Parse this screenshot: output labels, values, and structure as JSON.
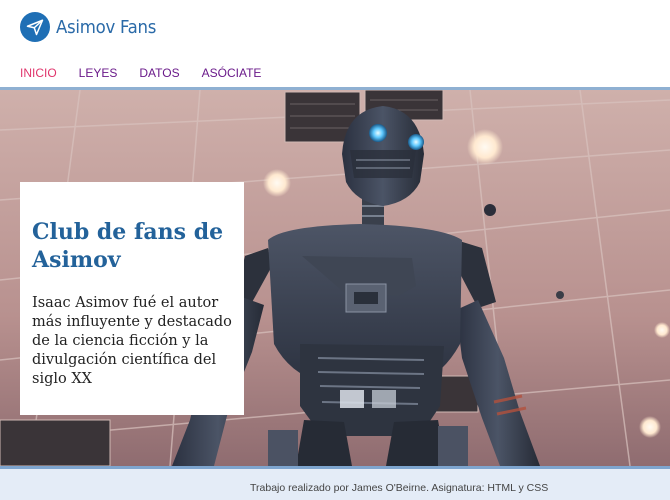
{
  "header": {
    "logo_text": "Asimov Fans",
    "logo_icon": "paper-plane-icon"
  },
  "nav": {
    "items": [
      "INICIO",
      "LEYES",
      "DATOS",
      "ASÓCIATE"
    ],
    "active": "INICIO"
  },
  "hero": {
    "title": "Club de fans de Asimov",
    "text": "Isaac Asimov fué el autor más influyente y destacado de la ciencia ficción y la divulgación científica del siglo XX",
    "image": "robot-photo"
  },
  "footer": {
    "text": "Trabajo realizado por James O'Beirne. Asignatura: HTML y CSS"
  },
  "colors": {
    "brand": "#2a6aa8",
    "nav": "#6a1a8a",
    "nav_active": "#e0356c",
    "title": "#23629a",
    "footer_bg": "#e4ecf7"
  }
}
